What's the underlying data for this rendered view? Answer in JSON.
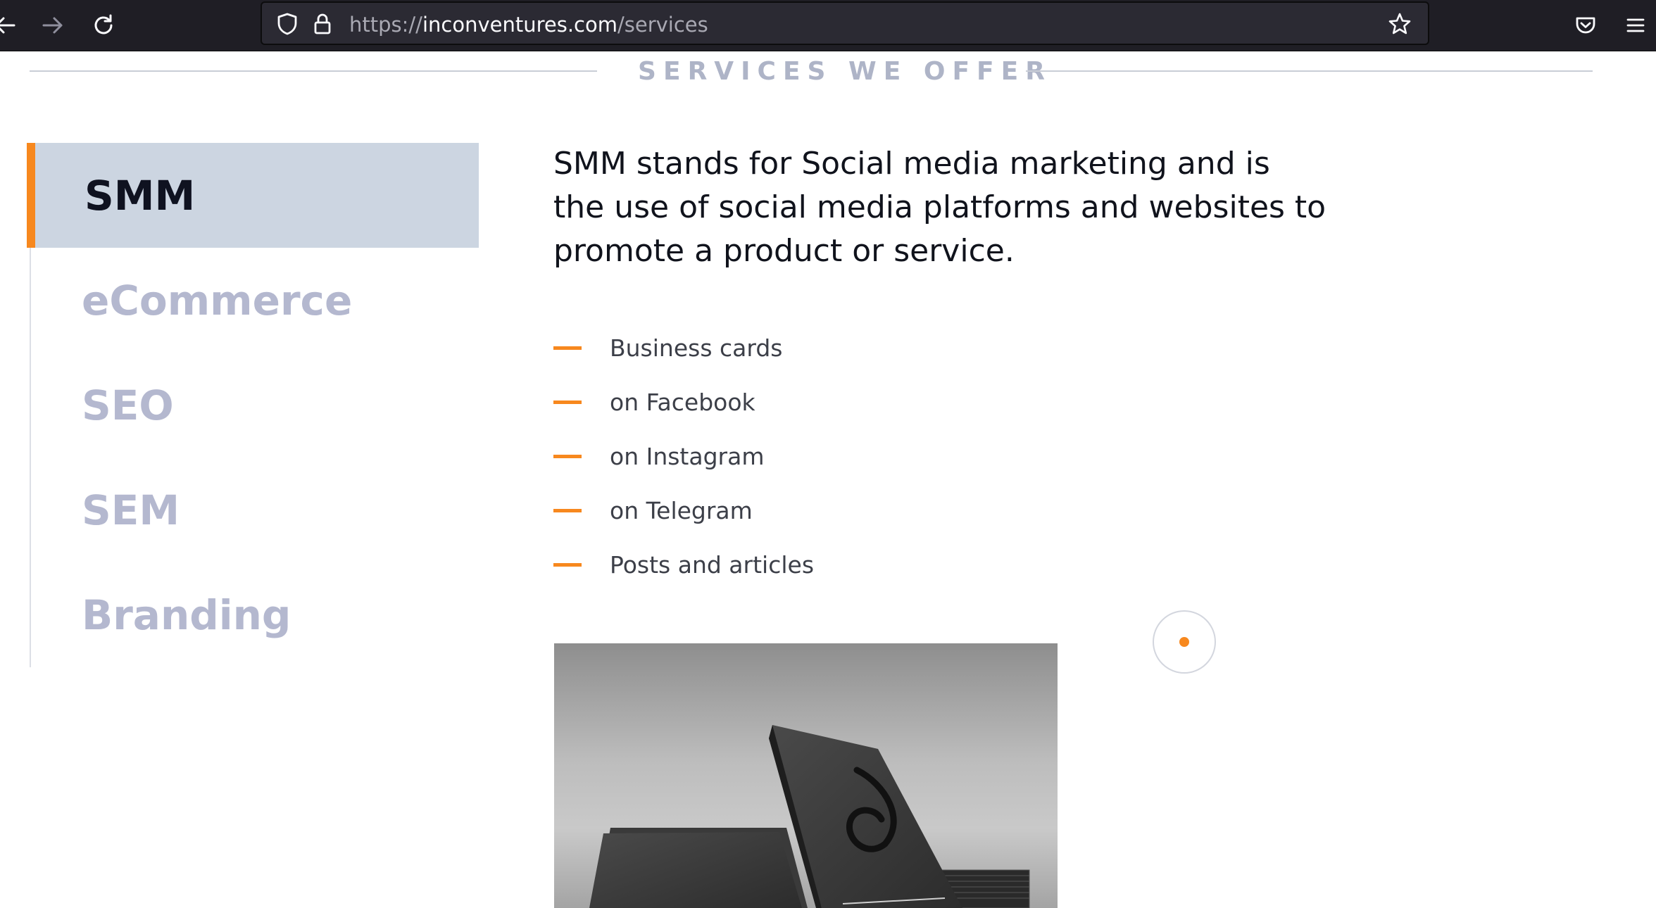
{
  "browser": {
    "url_scheme": "https://",
    "url_host": "inconventures.com",
    "url_path": "/services"
  },
  "page": {
    "section_heading": "SERVICES WE OFFER",
    "tabs": [
      {
        "label": "SMM",
        "active": true
      },
      {
        "label": "eCommerce",
        "active": false
      },
      {
        "label": "SEO",
        "active": false
      },
      {
        "label": "SEM",
        "active": false
      },
      {
        "label": "Branding",
        "active": false
      }
    ],
    "description": "SMM stands for Social media marketing and is the use of social media platforms and websites to promote a product or service.",
    "features": [
      "Business cards",
      "on Facebook",
      "on Instagram",
      "on Telegram",
      "Posts and articles"
    ],
    "image_icon": "business-cards-photo"
  },
  "colors": {
    "accent": "#f7881e",
    "active_tab_bg": "#ccd5e1",
    "inactive_tab_text": "#b4b8cf",
    "heading_text": "#aeb4c7"
  }
}
